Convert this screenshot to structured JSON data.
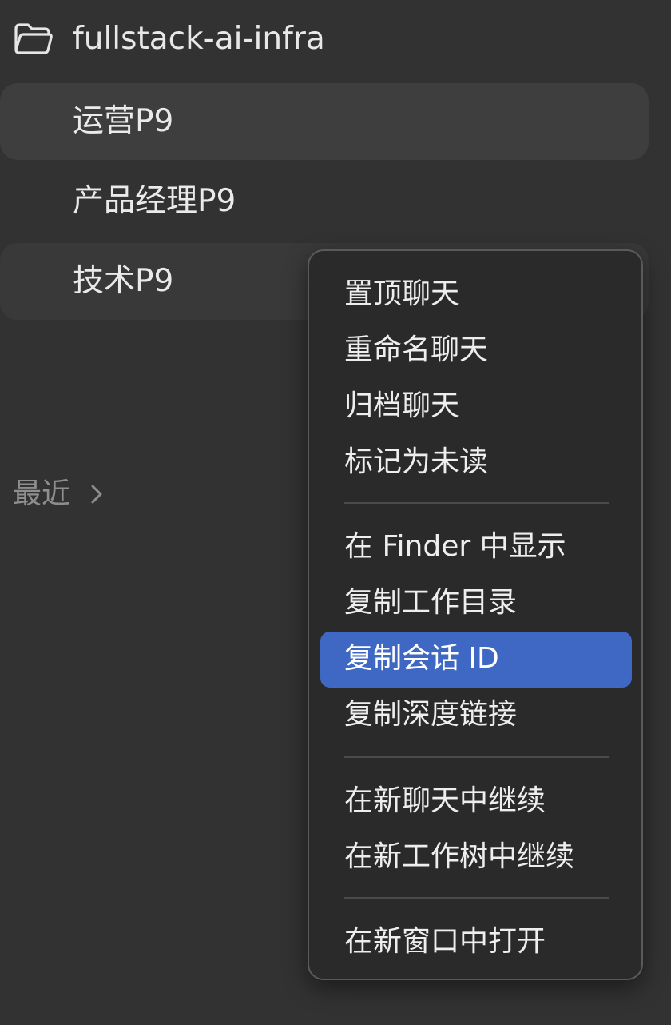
{
  "sidebar": {
    "folder": {
      "icon": "folder-icon",
      "name": "fullstack-ai-infra"
    },
    "chats": [
      {
        "label": "运营P9"
      },
      {
        "label": "产品经理P9"
      },
      {
        "label": "技术P9"
      }
    ],
    "recent": {
      "label": "最近",
      "icon": "chevron-right-icon"
    }
  },
  "context_menu": {
    "groups": [
      [
        {
          "label": "置顶聊天"
        },
        {
          "label": "重命名聊天"
        },
        {
          "label": "归档聊天"
        },
        {
          "label": "标记为未读"
        }
      ],
      [
        {
          "label": "在 Finder 中显示"
        },
        {
          "label": "复制工作目录"
        },
        {
          "label": "复制会话 ID"
        },
        {
          "label": "复制深度链接"
        }
      ],
      [
        {
          "label": "在新聊天中继续"
        },
        {
          "label": "在新工作树中继续"
        }
      ],
      [
        {
          "label": "在新窗口中打开"
        }
      ]
    ],
    "highlight_color": "#3f68c4"
  }
}
